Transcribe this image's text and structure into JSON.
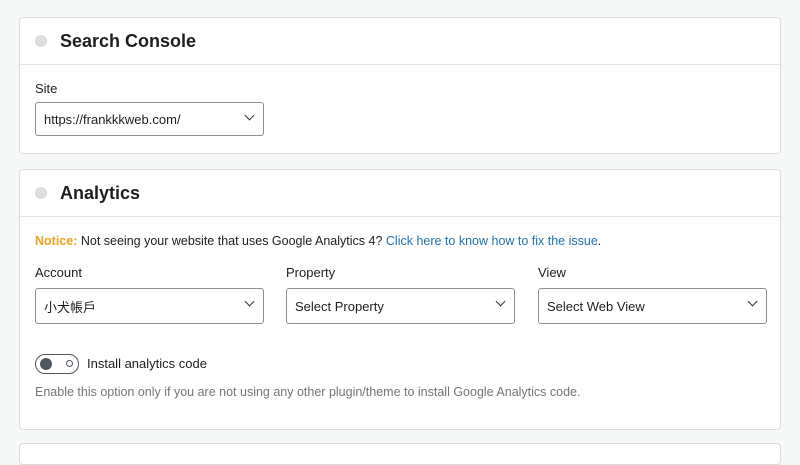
{
  "search_console": {
    "title": "Search Console",
    "site_label": "Site",
    "site_value": "https://frankkkweb.com/"
  },
  "analytics": {
    "title": "Analytics",
    "notice_label": "Notice:",
    "notice_text": " Not seeing your website that uses Google Analytics 4? ",
    "notice_link": "Click here to know how to fix the issue",
    "notice_end": ".",
    "account_label": "Account",
    "account_value": "小犬帳戶",
    "property_label": "Property",
    "property_value": "Select Property",
    "view_label": "View",
    "view_value": "Select Web View",
    "toggle_label": "Install analytics code",
    "toggle_on": false,
    "help_text": "Enable this option only if you are not using any other plugin/theme to install Google Analytics code."
  },
  "colors": {
    "notice": "#f0a020",
    "link": "#2271b1"
  }
}
